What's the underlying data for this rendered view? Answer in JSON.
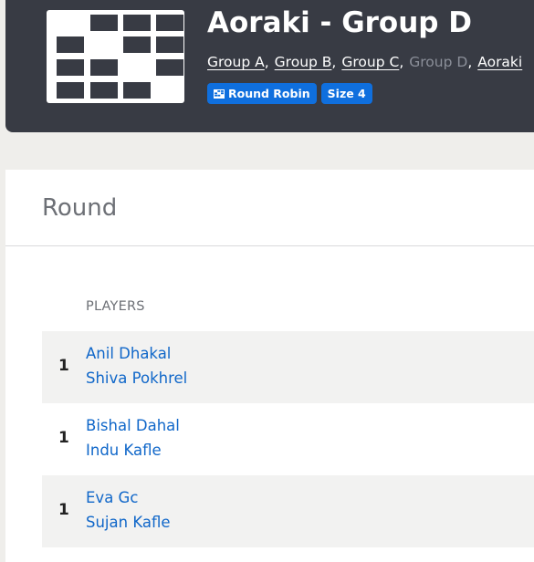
{
  "header": {
    "logo_icon": "round-robin-grid-icon",
    "title": "Aoraki - Group D",
    "breadcrumbs": [
      {
        "label": "Group A",
        "current": false
      },
      {
        "label": "Group B",
        "current": false
      },
      {
        "label": "Group C",
        "current": false
      },
      {
        "label": "Group D",
        "current": true
      },
      {
        "label": "Aoraki",
        "current": false
      }
    ],
    "separator": ",",
    "badges": {
      "format_icon": "grid-icon",
      "format_label": "Round Robin",
      "size_label": "Size 4"
    }
  },
  "round": {
    "title": "Round",
    "players_header": "PLAYERS",
    "matches": [
      {
        "number": "1",
        "player1": "Anil Dhakal",
        "player2": "Shiva Pokhrel"
      },
      {
        "number": "1",
        "player1": "Bishal Dahal",
        "player2": "Indu Kafle"
      },
      {
        "number": "1",
        "player1": "Eva Gc",
        "player2": "Sujan Kafle"
      }
    ]
  },
  "colors": {
    "header_bg": "#383b44",
    "accent_blue": "#0f6fde",
    "link_blue": "#1067c9",
    "page_bg": "#efeeeb",
    "row_shade": "#f2f2f1"
  }
}
